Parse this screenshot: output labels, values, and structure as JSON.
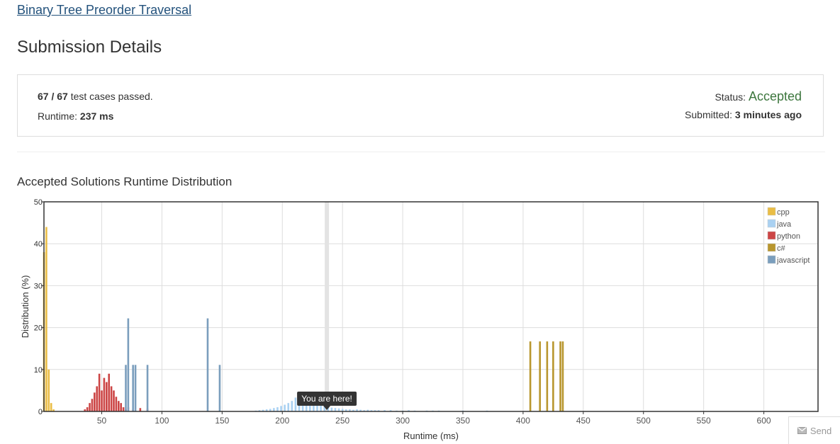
{
  "problem": {
    "link_text": "Binary Tree Preorder Traversal"
  },
  "page_title": "Submission Details",
  "details": {
    "passed_count": "67",
    "separator": "/",
    "total_count": "67",
    "passed_suffix": "test cases passed.",
    "runtime_label": "Runtime:",
    "runtime_value": "237 ms",
    "status_label": "Status:",
    "status_value": "Accepted",
    "submitted_label": "Submitted:",
    "submitted_value": "3 minutes ago"
  },
  "colors": {
    "accepted": "#3c763d",
    "link": "#23527c"
  },
  "distribution_title": "Accepted Solutions Runtime Distribution",
  "send_button": {
    "label": "Send",
    "icon": "mail-icon"
  },
  "chart_data": {
    "type": "bar",
    "xlabel": "Runtime (ms)",
    "ylabel": "Distribution (%)",
    "xlim": [
      2,
      645
    ],
    "ylim": [
      0,
      50
    ],
    "xticks": [
      50,
      100,
      150,
      200,
      250,
      300,
      350,
      400,
      450,
      500,
      550,
      600
    ],
    "xtick_labels": [
      "50",
      "100",
      "150",
      "200",
      "250",
      "300",
      "350",
      "400",
      "450",
      "500",
      "550",
      "600"
    ],
    "yticks": [
      0,
      10,
      20,
      30,
      40,
      50
    ],
    "grid": true,
    "legend_position": "top-right",
    "marker": {
      "x": 237,
      "label": "You are here!"
    },
    "series": [
      {
        "name": "cpp",
        "color": "#eabd45",
        "x": [
          2,
          4,
          6,
          8,
          10
        ],
        "values": [
          38,
          44,
          10,
          2,
          0.5
        ]
      },
      {
        "name": "java",
        "color": "#a9d1f2",
        "x": [
          178,
          181,
          184,
          187,
          190,
          193,
          196,
          199,
          202,
          205,
          208,
          211,
          214,
          217,
          220,
          223,
          226,
          229,
          232,
          235,
          238,
          241,
          244,
          247,
          250,
          253,
          256,
          259,
          262,
          265,
          268,
          271,
          274,
          277,
          280,
          285,
          290,
          295,
          300,
          305,
          310,
          320,
          325,
          330,
          350,
          370
        ],
        "values": [
          0.2,
          0.3,
          0.4,
          0.5,
          0.6,
          0.8,
          1.0,
          1.3,
          1.6,
          2.0,
          2.5,
          3.3,
          3.0,
          2.6,
          2.6,
          2.1,
          1.9,
          1.6,
          1.4,
          1.2,
          1.0,
          0.9,
          0.8,
          0.7,
          0.6,
          0.5,
          0.5,
          0.4,
          0.5,
          0.4,
          0.3,
          0.4,
          0.3,
          0.3,
          0.3,
          0.3,
          0.3,
          0.2,
          0.2,
          0.3,
          0.2,
          0.2,
          0.2,
          0.2,
          0.2,
          0.2
        ]
      },
      {
        "name": "python",
        "color": "#cc4545",
        "x": [
          36,
          38,
          40,
          42,
          44,
          46,
          48,
          50,
          52,
          54,
          56,
          58,
          60,
          62,
          64,
          66,
          68,
          70,
          72,
          76,
          82,
          88
        ],
        "values": [
          0.5,
          1,
          2,
          3,
          4.5,
          6,
          9,
          5,
          8,
          7,
          9,
          6,
          5,
          3.5,
          2.5,
          2,
          1,
          0.5,
          1,
          0.5,
          0.8,
          0.6
        ]
      },
      {
        "name": "c#",
        "color": "#b8962e",
        "x": [
          406,
          414,
          420,
          425,
          431,
          433
        ],
        "values": [
          16.7,
          16.7,
          16.7,
          16.7,
          16.7,
          16.7
        ]
      },
      {
        "name": "javascript",
        "color": "#7b9ebd",
        "x": [
          70,
          72,
          76,
          78,
          88,
          138,
          148
        ],
        "values": [
          11.1,
          22.2,
          11.1,
          11.1,
          11.1,
          22.2,
          11.1
        ]
      }
    ]
  }
}
